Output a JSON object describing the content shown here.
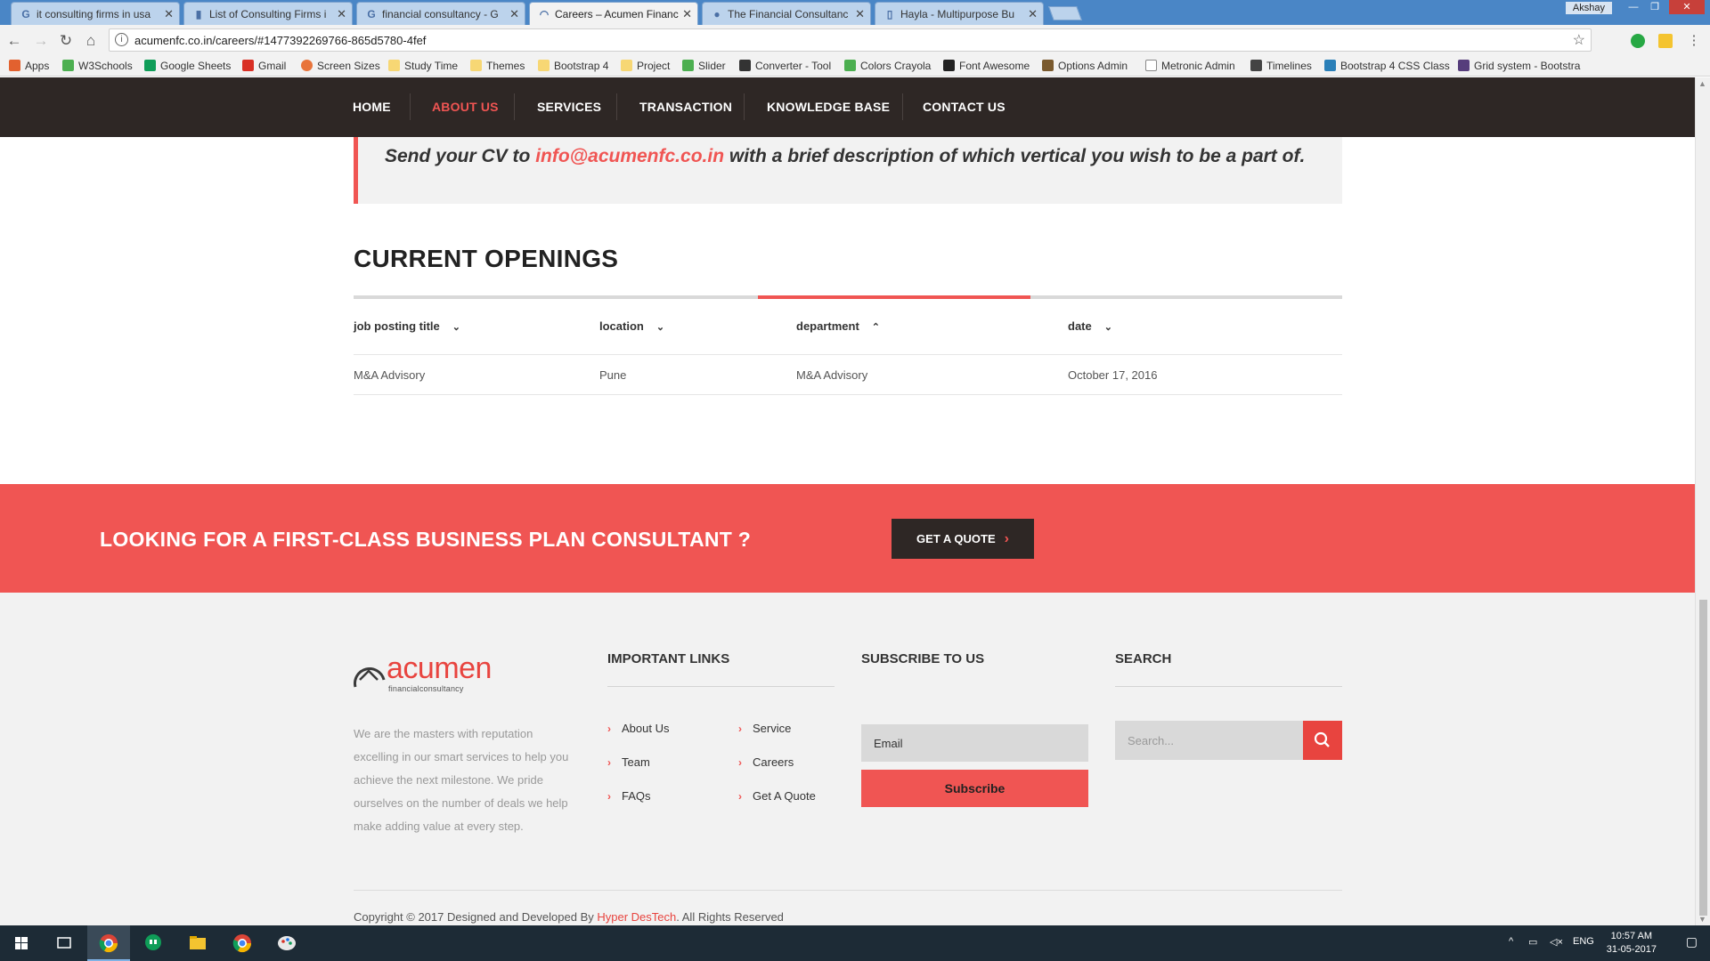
{
  "browser": {
    "tabs": [
      {
        "title": "it consulting firms in usa",
        "active": false
      },
      {
        "title": "List of Consulting Firms i",
        "active": false
      },
      {
        "title": "financial consultancy - G",
        "active": false
      },
      {
        "title": "Careers – Acumen Financ",
        "active": true
      },
      {
        "title": "The Financial Consultanc",
        "active": false
      },
      {
        "title": "Hayla - Multipurpose Bu",
        "active": false
      }
    ],
    "user": "Akshay",
    "url": "acumenfc.co.in/careers/#1477392269766-865d5780-4fef",
    "bookmarks": [
      "Apps",
      "W3Schools",
      "Google Sheets",
      "Gmail",
      "Screen Sizes",
      "Study Time",
      "Themes",
      "Bootstrap 4",
      "Project",
      "Slider",
      "Converter - Tool",
      "Colors Crayola",
      "Font Awesome",
      "Options Admin",
      "Metronic Admin",
      "Timelines",
      "Bootstrap 4 CSS Class",
      "Grid system - Bootstra"
    ]
  },
  "nav": {
    "items": [
      "HOME",
      "ABOUT US",
      "SERVICES",
      "TRANSACTION",
      "KNOWLEDGE BASE",
      "CONTACT US"
    ],
    "active": "ABOUT US"
  },
  "quote": {
    "before": "Send your CV to ",
    "email": "info@acumenfc.co.in",
    "after": " with a brief description of which vertical you wish to be a part of."
  },
  "openings": {
    "title": "CURRENT OPENINGS",
    "columns": [
      "job posting title",
      "location",
      "department",
      "date"
    ],
    "rows": [
      [
        "M&A Advisory",
        "Pune",
        "M&A Advisory",
        "October 17, 2016"
      ]
    ]
  },
  "cta": {
    "text": "LOOKING FOR A FIRST-CLASS BUSINESS PLAN CONSULTANT ?",
    "button": "GET A QUOTE"
  },
  "footer": {
    "logo_word": "acumen",
    "logo_sub": "financialconsultancy",
    "about": "We are the masters with reputation excelling in our smart services to help you achieve the next milestone. We pride ourselves on the number of deals we help make adding value at every step.",
    "links_heading": "IMPORTANT LINKS",
    "links": [
      "About Us",
      "Team",
      "FAQs",
      "Service",
      "Careers",
      "Get A Quote"
    ],
    "subscribe_heading": "SUBSCRIBE TO US",
    "email_placeholder": "Email",
    "subscribe_button": "Subscribe",
    "search_heading": "SEARCH",
    "search_placeholder": "Search...",
    "copyright_before": "Copyright © 2017 Designed and Developed By ",
    "copyright_brand": "Hyper DesTech",
    "copyright_after": ". All Rights Reserved"
  },
  "taskbar": {
    "lang": "ENG",
    "time": "10:57 AM",
    "date": "31-05-2017"
  },
  "colors": {
    "accent": "#f05553",
    "nav_bg": "#2e2725",
    "footer_bg": "#f2f2f2"
  }
}
